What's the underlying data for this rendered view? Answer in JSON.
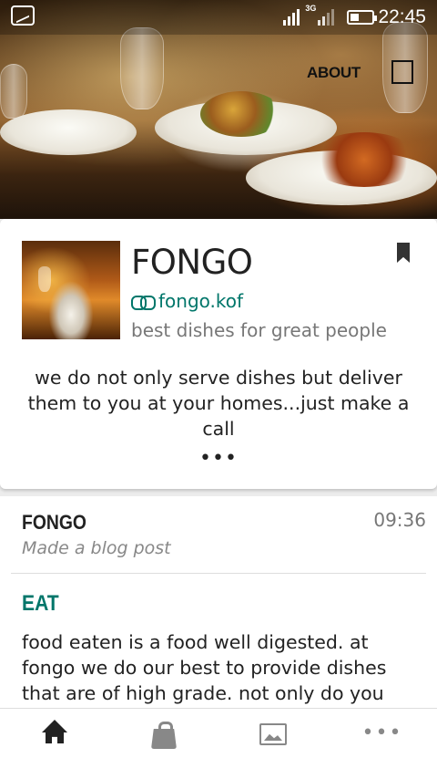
{
  "status_bar": {
    "network_label": "3G",
    "time": "22:45"
  },
  "header": {
    "about_label": "ABOUT"
  },
  "profile": {
    "title": "FONGO",
    "link": "fongo.kof",
    "tagline": "best dishes for great people",
    "description": "we do not only serve dishes but deliver them to you at your homes...just make a call",
    "more": "•••"
  },
  "post": {
    "author": "FONGO",
    "time": "09:36",
    "action": "Made a blog post",
    "heading": "EAT",
    "body": "food eaten is a food well digested. at fongo we do our best to provide dishes that are of high grade. not only do you eat to get"
  },
  "bottom_nav": {
    "items": [
      {
        "icon": "home-icon",
        "active": true
      },
      {
        "icon": "shopping-bag-icon",
        "active": false
      },
      {
        "icon": "photo-icon",
        "active": false
      },
      {
        "icon": "more-icon",
        "label": "•••",
        "active": false
      }
    ]
  },
  "colors": {
    "accent": "#00766a",
    "text": "#222222",
    "muted": "#777777"
  }
}
